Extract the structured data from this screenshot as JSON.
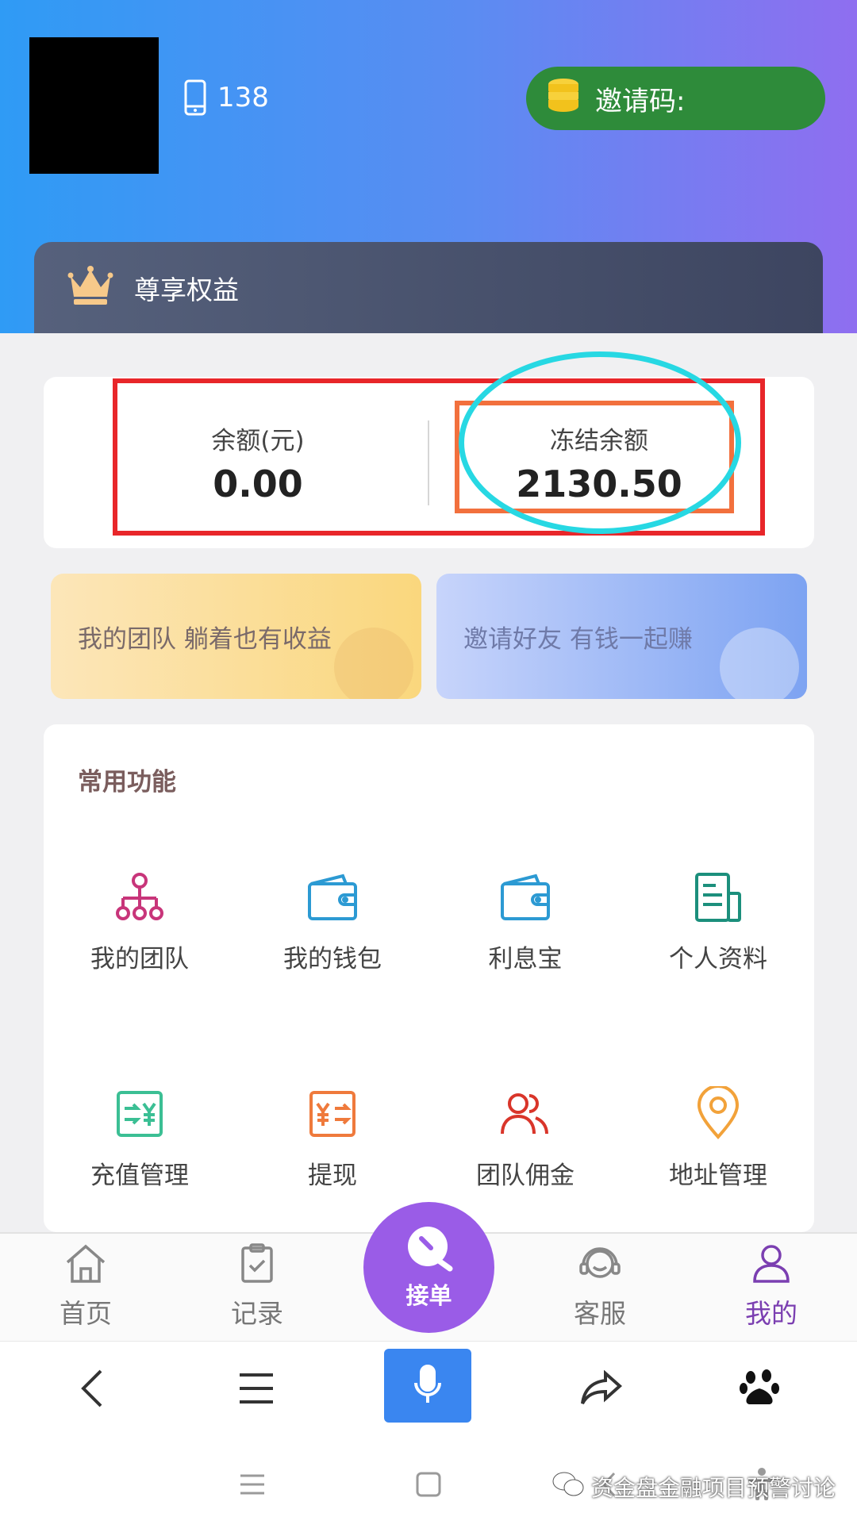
{
  "header": {
    "phone": "138",
    "invite_label": "邀请码:",
    "vip_label": "尊享权益"
  },
  "balance": {
    "available_label": "余额(元)",
    "available_value": "0.00",
    "frozen_label": "冻结余额",
    "frozen_value": "2130.50"
  },
  "promos": {
    "team": "我的团队 躺着也有收益",
    "invite": "邀请好友 有钱一起赚"
  },
  "functions": {
    "title": "常用功能",
    "items": [
      {
        "label": "我的团队",
        "icon": "team-tree-icon"
      },
      {
        "label": "我的钱包",
        "icon": "wallet-icon"
      },
      {
        "label": "利息宝",
        "icon": "wallet-icon"
      },
      {
        "label": "个人资料",
        "icon": "document-icon"
      },
      {
        "label": "充值管理",
        "icon": "recharge-icon"
      },
      {
        "label": "提现",
        "icon": "withdraw-icon"
      },
      {
        "label": "团队佣金",
        "icon": "users-icon"
      },
      {
        "label": "地址管理",
        "icon": "location-pin-icon"
      }
    ]
  },
  "tabbar": {
    "home": "首页",
    "records": "记录",
    "center": "接单",
    "service": "客服",
    "mine": "我的"
  },
  "watermark": "资金盘金融项目预警讨论",
  "colors": {
    "header_start": "#2f9bf5",
    "header_end": "#8f6ef0",
    "invite_bg": "#2e8b3a",
    "accent_purple": "#9a5ce7",
    "highlight_red": "#e8262a",
    "highlight_orange": "#f2703d",
    "highlight_cyan": "#27d8e3"
  }
}
